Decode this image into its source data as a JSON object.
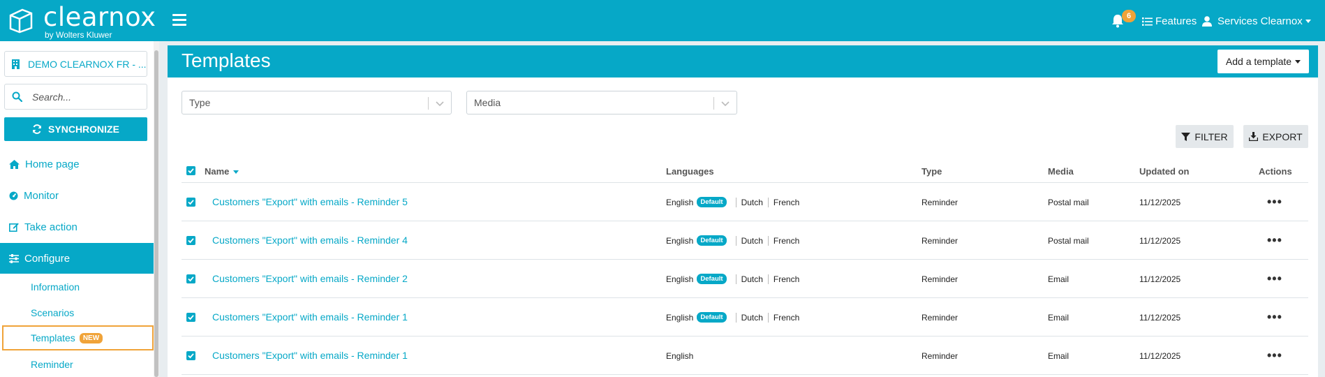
{
  "app": {
    "brand": "clearnox",
    "brand_sub": "by Wolters Kluwer",
    "notifications_count": "6",
    "features_label": "Features",
    "user_label": "Services Clearnox"
  },
  "sidebar": {
    "company": "DEMO CLEARNOX FR - ...",
    "search_placeholder": "Search...",
    "sync_label": "SYNCHRONIZE",
    "nav": [
      {
        "label": "Home page",
        "icon": "home-icon"
      },
      {
        "label": "Monitor",
        "icon": "gauge-icon"
      },
      {
        "label": "Take action",
        "icon": "edit-icon"
      },
      {
        "label": "Configure",
        "icon": "sliders-icon"
      }
    ],
    "sub": [
      {
        "label": "Information"
      },
      {
        "label": "Scenarios"
      },
      {
        "label": "Templates",
        "badge": "NEW"
      },
      {
        "label": "Reminder"
      }
    ]
  },
  "main": {
    "title": "Templates",
    "add_button": "Add a template",
    "filters": {
      "type_placeholder": "Type",
      "media_placeholder": "Media"
    },
    "filter_button": "FILTER",
    "export_button": "EXPORT",
    "columns": [
      "Name",
      "Languages",
      "Type",
      "Media",
      "Updated on",
      "Actions"
    ],
    "default_badge": "Default",
    "rows": [
      {
        "name": "Customers \"Export\" with emails - Reminder 5",
        "langs": [
          "English",
          "Dutch",
          "French"
        ],
        "type": "Reminder",
        "media": "Postal mail",
        "updated": "11/12/2025"
      },
      {
        "name": "Customers \"Export\" with emails - Reminder 4",
        "langs": [
          "English",
          "Dutch",
          "French"
        ],
        "type": "Reminder",
        "media": "Postal mail",
        "updated": "11/12/2025"
      },
      {
        "name": "Customers \"Export\" with emails - Reminder 2",
        "langs": [
          "English",
          "Dutch",
          "French"
        ],
        "type": "Reminder",
        "media": "Email",
        "updated": "11/12/2025"
      },
      {
        "name": "Customers \"Export\" with emails - Reminder 1",
        "langs": [
          "English",
          "Dutch",
          "French"
        ],
        "type": "Reminder",
        "media": "Email",
        "updated": "11/12/2025"
      },
      {
        "name": "Customers \"Export\" with emails - Reminder 1",
        "langs": [
          "English"
        ],
        "type": "Reminder",
        "media": "Email",
        "updated": "11/12/2025"
      }
    ]
  },
  "colors": {
    "accent": "#06a8c7",
    "highlight": "#f0a339"
  }
}
